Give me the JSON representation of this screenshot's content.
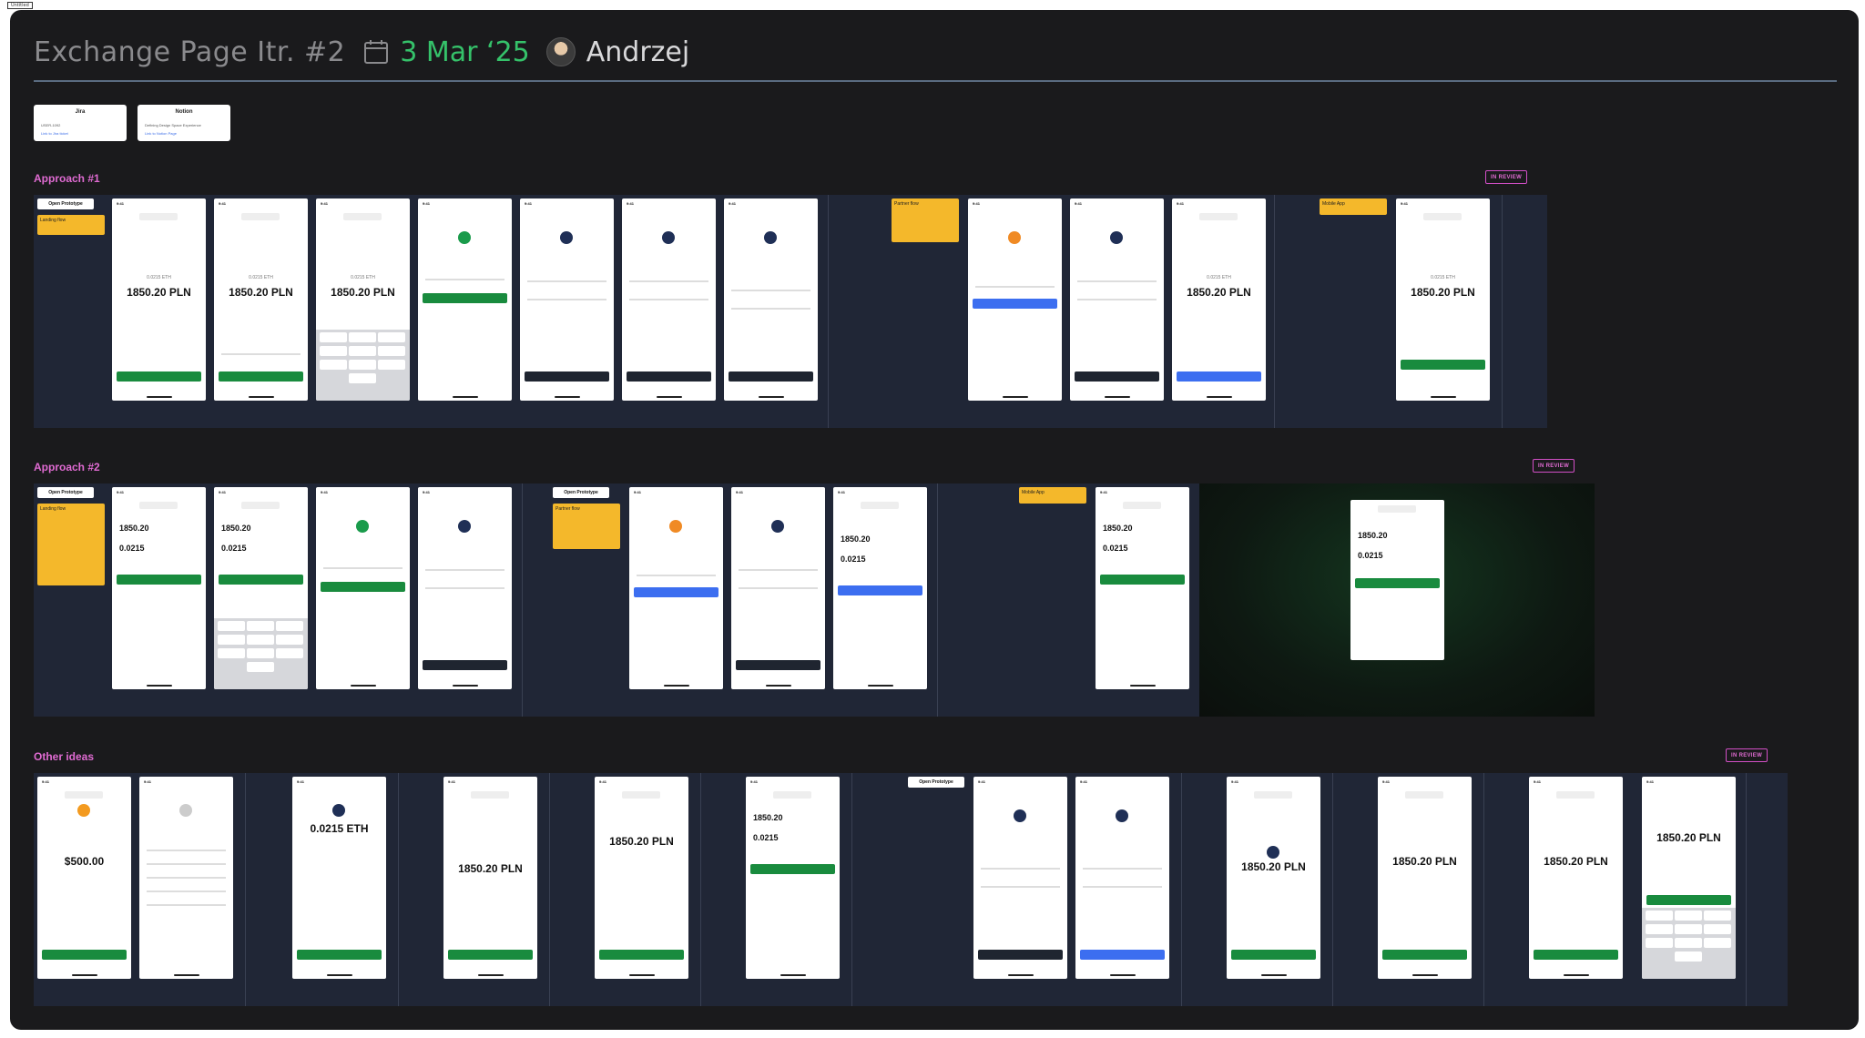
{
  "corner_tag": "Untitled",
  "header": {
    "title": "Exchange Page Itr. #2",
    "date": "3 Mar ‘25",
    "author": "Andrzej"
  },
  "links": [
    {
      "name": "Jira",
      "line1": "USER-1092",
      "line2": "Link to Jira ticket"
    },
    {
      "name": "Notion",
      "line1": "Defining Design Space Experience",
      "line2": "Link to Notion Page"
    }
  ],
  "sections": [
    {
      "title": "Approach #1",
      "badge": "IN REVIEW"
    },
    {
      "title": "Approach #2",
      "badge": "IN REVIEW"
    },
    {
      "title": "Other ideas",
      "badge": "IN REVIEW"
    }
  ],
  "strip_labels": {
    "open_prototype": "Open Prototype",
    "landing_flow": "Landing flow",
    "partner_flow": "Partner flow",
    "mobile_app": "Mobile App",
    "amount_pln": "1850.20 PLN",
    "amount_eth": "0.0215 ETH",
    "amount_usd": "$500.00"
  },
  "colors": {
    "board": "#1a1a1c",
    "title": "#8a8a8d",
    "date": "#35c26a",
    "accent": "#e06bd2",
    "strip": "#202636"
  }
}
